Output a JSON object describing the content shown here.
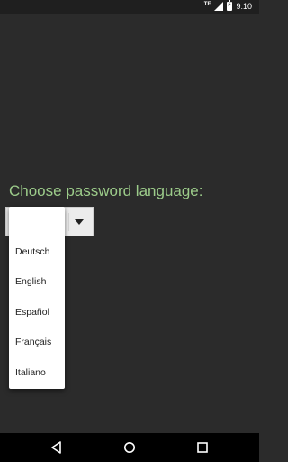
{
  "status_bar": {
    "network": "LTE",
    "time": "9:10"
  },
  "prompt": {
    "text": "Choose password language:"
  },
  "language_spinner": {
    "selected": "",
    "options": [
      "Deutsch",
      "English",
      "Español",
      "Français",
      "Italiano"
    ]
  },
  "icons": {
    "signal": "signal-icon",
    "battery": "battery-charging-icon",
    "back": "back-icon",
    "home": "home-icon",
    "recents": "recents-icon",
    "dropdown_caret": "caret-down-icon"
  },
  "colors": {
    "background": "#2b2b2b",
    "prompt_text": "#9ccc8a",
    "dropdown_bg": "#ffffff"
  }
}
